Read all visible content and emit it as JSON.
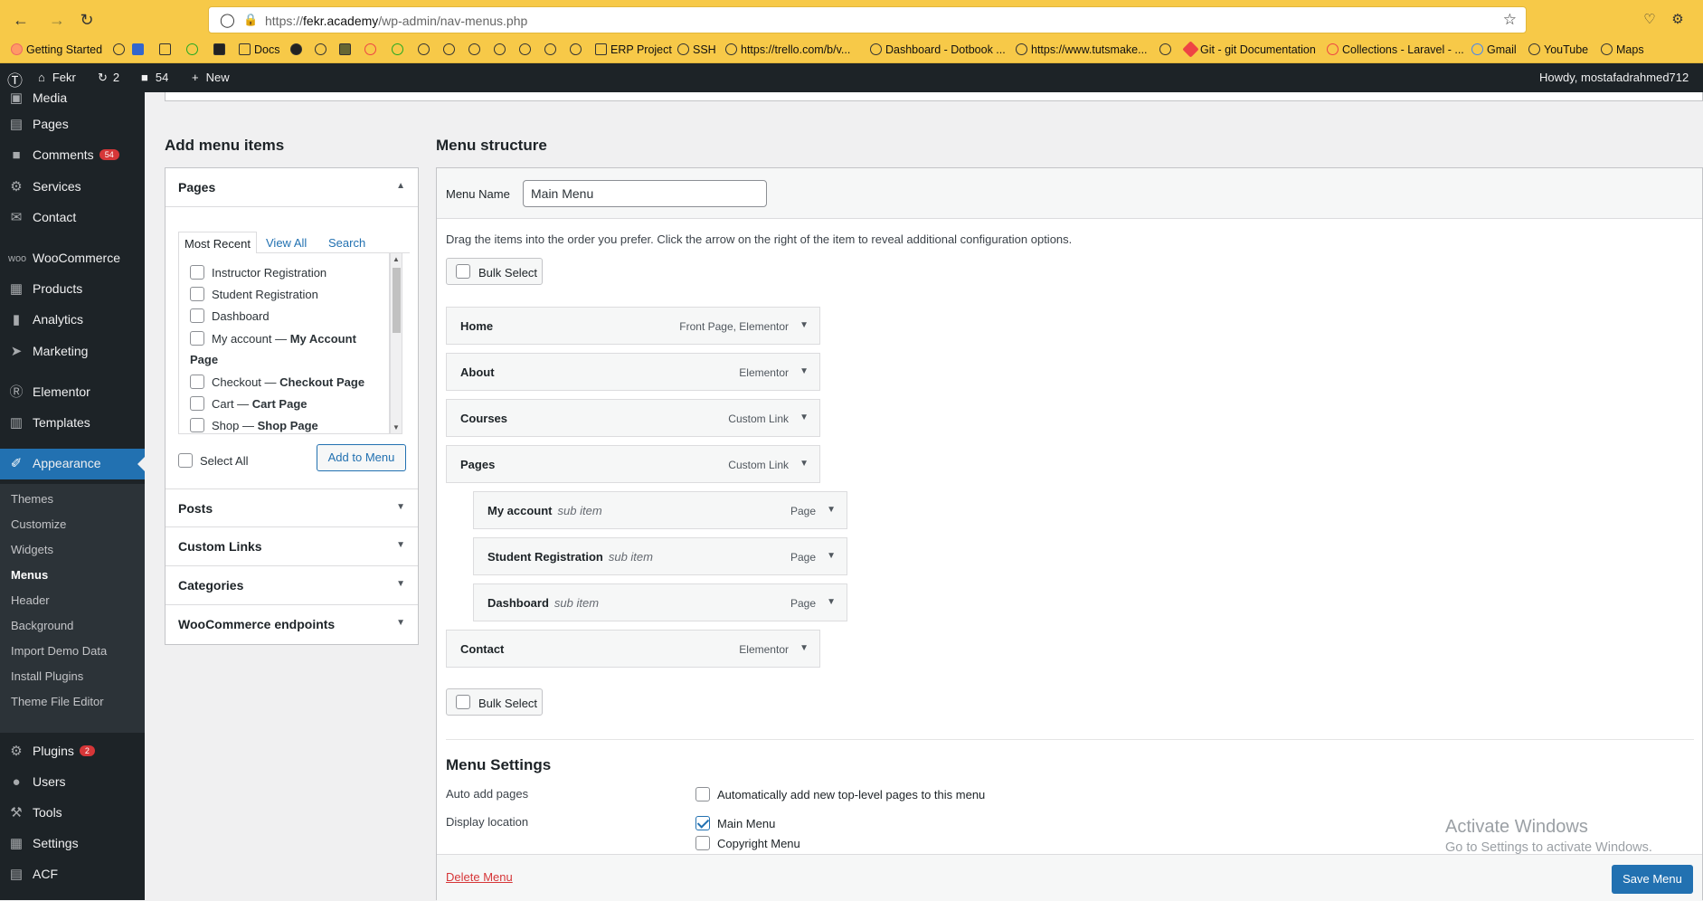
{
  "browser": {
    "url_prefix": "https://",
    "url_domain": "fekr.academy",
    "url_path": "/wp-admin/nav-menus.php"
  },
  "bookmarks": [
    {
      "label": "Getting Started"
    },
    {
      "label": "Docs"
    },
    {
      "label": "ERP Project"
    },
    {
      "label": "SSH"
    },
    {
      "label": "https://trello.com/b/v..."
    },
    {
      "label": "Dashboard - Dotbook ..."
    },
    {
      "label": "https://www.tutsmake..."
    },
    {
      "label": "Git - git Documentation"
    },
    {
      "label": "Collections - Laravel - ..."
    },
    {
      "label": "Gmail"
    },
    {
      "label": "YouTube"
    },
    {
      "label": "Maps"
    }
  ],
  "adminbar": {
    "site": "Fekr",
    "updates": "2",
    "comments": "54",
    "new": "New",
    "howdy": "Howdy, mostafadrahmed712"
  },
  "sidebar": {
    "items": [
      {
        "label": "Media"
      },
      {
        "label": "Pages"
      },
      {
        "label": "Comments",
        "badge": "54"
      },
      {
        "label": "Services"
      },
      {
        "label": "Contact"
      },
      {
        "label": "WooCommerce"
      },
      {
        "label": "Products"
      },
      {
        "label": "Analytics"
      },
      {
        "label": "Marketing"
      },
      {
        "label": "Elementor"
      },
      {
        "label": "Templates"
      },
      {
        "label": "Appearance"
      },
      {
        "label": "Plugins",
        "badge": "2"
      },
      {
        "label": "Users"
      },
      {
        "label": "Tools"
      },
      {
        "label": "Settings"
      },
      {
        "label": "ACF"
      }
    ],
    "submenu": [
      "Themes",
      "Customize",
      "Widgets",
      "Menus",
      "Header",
      "Background",
      "Import Demo Data",
      "Install Plugins",
      "Theme File Editor"
    ]
  },
  "add_items": {
    "title": "Add menu items",
    "pages_label": "Pages",
    "tabs": [
      "Most Recent",
      "View All",
      "Search"
    ],
    "pages": [
      "Instructor Registration",
      "Student Registration",
      "Dashboard",
      "My account — ",
      "Page",
      "Checkout — ",
      "Cart — ",
      "Shop — "
    ],
    "page_suffix": [
      "My Account",
      "Checkout Page",
      "Cart Page",
      "Shop Page"
    ],
    "select_all": "Select All",
    "add_button": "Add to Menu",
    "sections": [
      "Posts",
      "Custom Links",
      "Categories",
      "WooCommerce endpoints"
    ]
  },
  "structure": {
    "title": "Menu structure",
    "menu_name_label": "Menu Name",
    "menu_name_value": "Main Menu",
    "instructions": "Drag the items into the order you prefer. Click the arrow on the right of the item to reveal additional configuration options.",
    "bulk_select": "Bulk Select",
    "items": [
      {
        "title": "Home",
        "type": "Front Page, Elementor"
      },
      {
        "title": "About",
        "type": "Elementor"
      },
      {
        "title": "Courses",
        "type": "Custom Link"
      },
      {
        "title": "Pages",
        "type": "Custom Link"
      },
      {
        "title": "My account",
        "sub": "sub item",
        "type": "Page"
      },
      {
        "title": "Student Registration",
        "sub": "sub item",
        "type": "Page"
      },
      {
        "title": "Dashboard",
        "sub": "sub item",
        "type": "Page"
      },
      {
        "title": "Contact",
        "type": "Elementor"
      }
    ]
  },
  "settings": {
    "title": "Menu Settings",
    "auto_add_label": "Auto add pages",
    "auto_add_text": "Automatically add new top-level pages to this menu",
    "display_label": "Display location",
    "locations": [
      {
        "label": "Main Menu",
        "checked": true
      },
      {
        "label": "Copyright Menu",
        "checked": false
      }
    ]
  },
  "footer": {
    "delete": "Delete Menu",
    "save": "Save Menu"
  },
  "watermark": {
    "line1": "Activate Windows",
    "line2": "Go to Settings to activate Windows."
  },
  "colors": {
    "browser_chrome": "#f7c948",
    "admin_dark": "#1d2327",
    "accent": "#2271b1",
    "badge": "#d63638",
    "delete": "#d63638"
  }
}
